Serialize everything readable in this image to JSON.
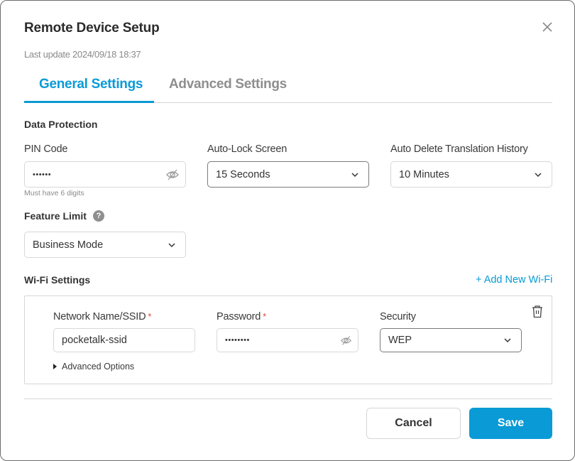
{
  "dialog": {
    "title": "Remote Device Setup",
    "last_update": "Last update 2024/09/18 18:37",
    "close_icon": "close-icon"
  },
  "tabs": [
    {
      "label": "General Settings",
      "active": true
    },
    {
      "label": "Advanced Settings",
      "active": false
    }
  ],
  "data_protection": {
    "section_title": "Data Protection",
    "pin_code": {
      "label": "PIN Code",
      "value": "••••••",
      "hint": "Must have 6 digits",
      "icon": "eye-slash-icon"
    },
    "auto_lock": {
      "label": "Auto-Lock Screen",
      "value": "15 Seconds"
    },
    "auto_delete": {
      "label": "Auto Delete Translation History",
      "value": "10 Minutes"
    }
  },
  "feature_limit": {
    "section_title": "Feature Limit",
    "help_icon": "?",
    "value": "Business Mode"
  },
  "wifi": {
    "section_title": "Wi-Fi Settings",
    "add_label": "+ Add New Wi-Fi",
    "entries": [
      {
        "ssid_label": "Network Name/SSID",
        "ssid_value": "pocketalk-ssid",
        "password_label": "Password",
        "password_value": "••••••••",
        "security_label": "Security",
        "security_value": "WEP",
        "required_mark": "*",
        "advanced_options_label": "Advanced Options"
      }
    ]
  },
  "footer": {
    "cancel_label": "Cancel",
    "save_label": "Save"
  },
  "colors": {
    "accent": "#0a9ad6",
    "required": "#e04b3a",
    "muted_text": "#8a8a8a"
  }
}
